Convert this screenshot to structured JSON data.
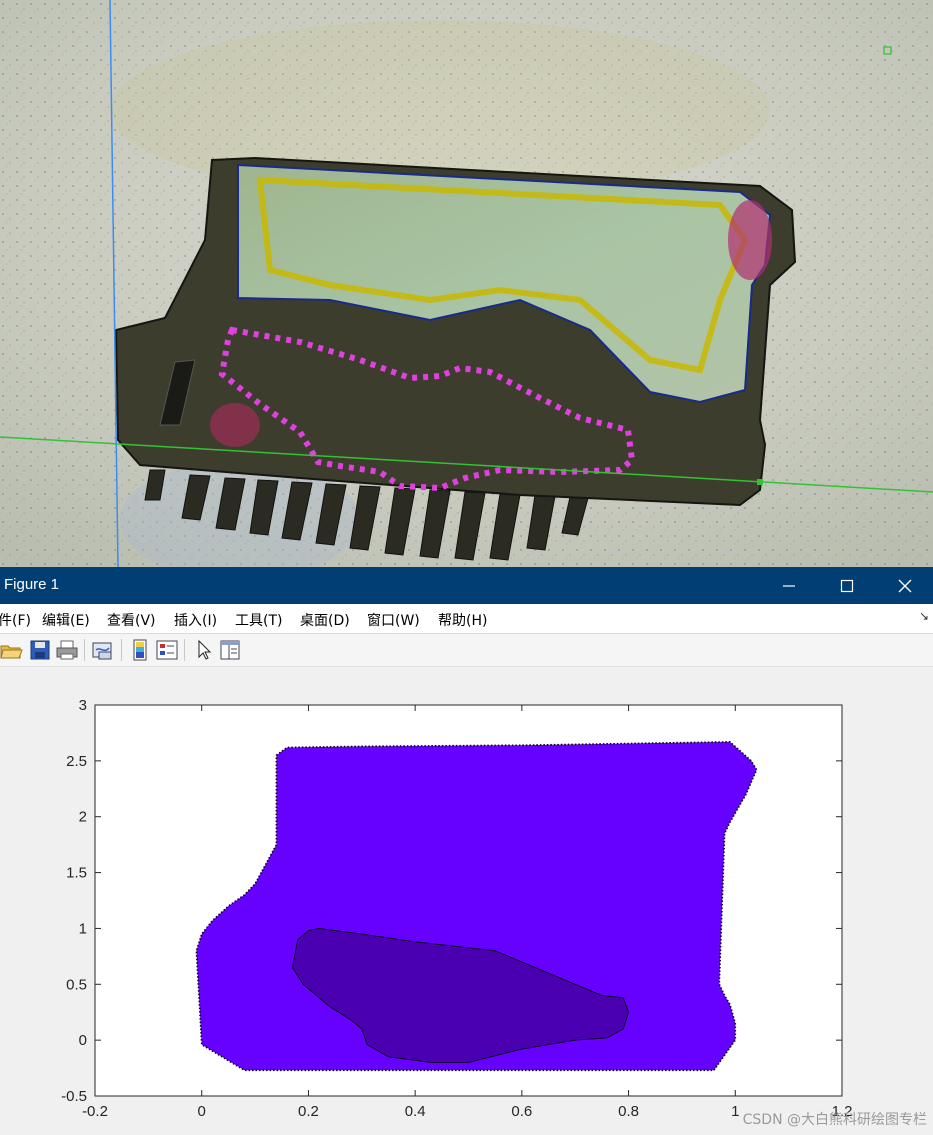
{
  "window": {
    "title": "Figure 1",
    "controls": [
      "minimize-icon",
      "maximize-icon",
      "close-icon"
    ]
  },
  "menu": {
    "items": [
      "件(F)",
      "编辑(E)",
      "查看(V)",
      "插入(I)",
      "工具(T)",
      "桌面(D)",
      "窗口(W)",
      "帮助(H)"
    ],
    "corner": "↘"
  },
  "toolbar": {
    "icons": [
      "open-file-icon",
      "save-icon",
      "print-icon",
      "link-plot-icon",
      "colorbar-icon",
      "legend-icon",
      "pointer-icon",
      "property-editor-icon"
    ]
  },
  "chart_data": {
    "type": "area",
    "xlim": [
      -0.2,
      1.2
    ],
    "ylim": [
      -0.5,
      3
    ],
    "xticks": [
      "-0.2",
      "0",
      "0.2",
      "0.4",
      "0.6",
      "0.8",
      "1",
      "1.2"
    ],
    "yticks": [
      "-0.5",
      "0",
      "0.5",
      "1",
      "1.5",
      "2",
      "2.5",
      "3"
    ],
    "grid": false,
    "series": [
      {
        "color": "#6600ff",
        "edge": "dotted-black",
        "x": [
          0.14,
          0.16,
          0.3,
          0.6,
          0.99,
          1.03,
          1.04,
          1.02,
          0.99,
          0.98,
          0.97,
          0.98,
          0.99,
          1.0,
          1.0,
          0.96,
          0.08,
          0.0,
          -0.01,
          0.0,
          0.02,
          0.05,
          0.08,
          0.1,
          0.14,
          0.14
        ],
        "y": [
          2.55,
          2.62,
          2.63,
          2.64,
          2.67,
          2.5,
          2.42,
          2.2,
          1.95,
          1.85,
          0.5,
          0.4,
          0.32,
          0.15,
          0.0,
          -0.27,
          -0.27,
          -0.04,
          0.8,
          0.95,
          1.07,
          1.2,
          1.3,
          1.4,
          1.75,
          2.55
        ]
      },
      {
        "color": "#4a00b0",
        "edge": "thin-black",
        "x": [
          0.18,
          0.2,
          0.22,
          0.3,
          0.4,
          0.55,
          0.65,
          0.75,
          0.79,
          0.8,
          0.79,
          0.76,
          0.7,
          0.6,
          0.5,
          0.43,
          0.35,
          0.31,
          0.3,
          0.28,
          0.24,
          0.19,
          0.17,
          0.18
        ],
        "y": [
          0.9,
          0.98,
          1.0,
          0.95,
          0.88,
          0.8,
          0.6,
          0.4,
          0.38,
          0.25,
          0.1,
          0.02,
          0.0,
          -0.08,
          -0.2,
          -0.2,
          -0.15,
          -0.04,
          0.1,
          0.18,
          0.3,
          0.5,
          0.65,
          0.9
        ]
      }
    ]
  }
}
